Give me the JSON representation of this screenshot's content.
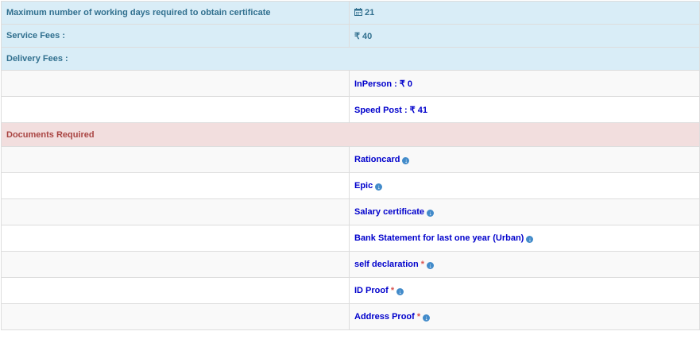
{
  "rows": {
    "max_days": {
      "label": "Maximum number of working days required to obtain certificate",
      "value": "21"
    },
    "service_fees": {
      "label": "Service Fees :",
      "value": "₹ 40"
    },
    "delivery_fees": {
      "label": "Delivery Fees :"
    },
    "in_person": {
      "value": "InPerson : ₹ 0"
    },
    "speed_post": {
      "value": "Speed Post : ₹ 41"
    },
    "documents": {
      "label": "Documents Required"
    }
  },
  "documents": [
    {
      "name": "Rationcard",
      "required": ""
    },
    {
      "name": "Epic",
      "required": ""
    },
    {
      "name": "Salary certificate",
      "required": ""
    },
    {
      "name": "Bank Statement for last one year (Urban)",
      "required": ""
    },
    {
      "name": "self declaration",
      "required": "*"
    },
    {
      "name": "ID Proof",
      "required": "*"
    },
    {
      "name": "Address Proof",
      "required": "*"
    }
  ],
  "icons": {
    "calendar": "calendar-icon",
    "expand": "circle-arrow-down-icon"
  },
  "colors": {
    "info_bg": "#d9edf7",
    "info_text": "#31708f",
    "danger_bg": "#f2dede",
    "danger_text": "#a94442",
    "link": "#0000cc",
    "required": "#d9534f",
    "icon": "#428bca"
  }
}
